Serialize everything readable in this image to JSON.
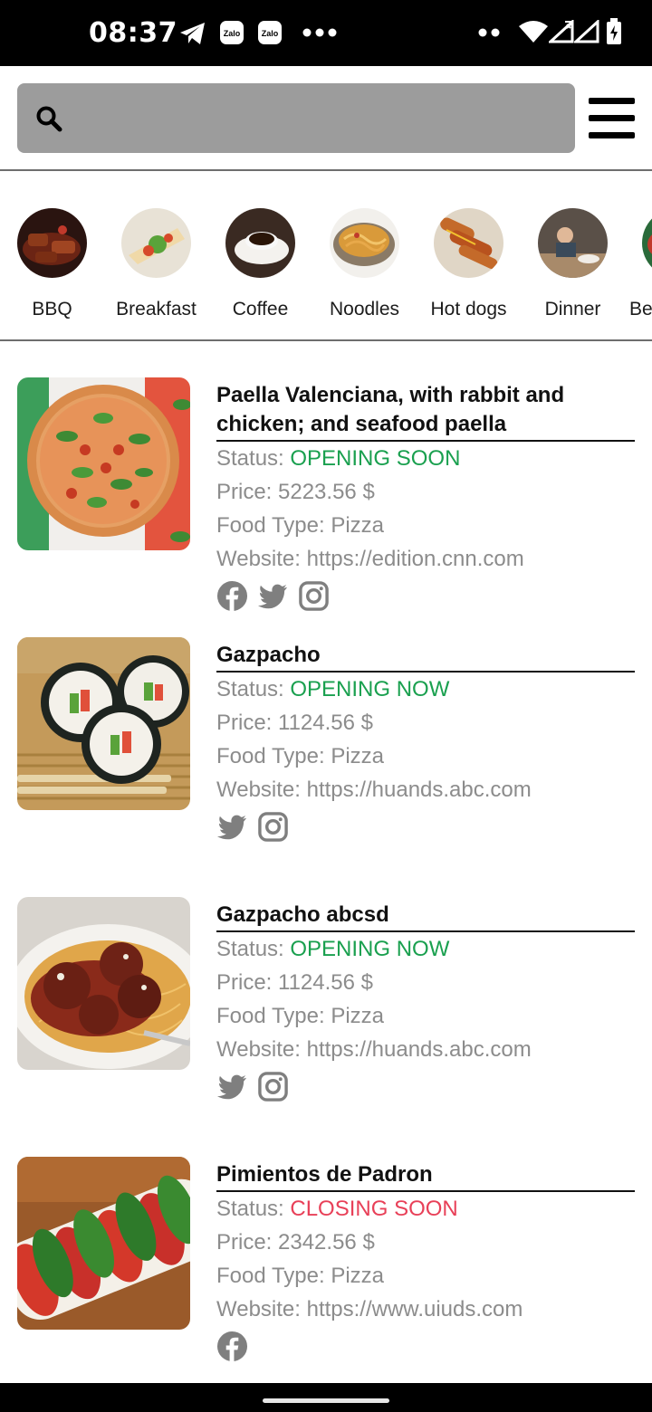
{
  "status_bar": {
    "time": "08:37",
    "left_icons": [
      "telegram-icon",
      "zalo-icon",
      "zalo-icon",
      "more-dots-icon"
    ],
    "zalo_text": "Zalo",
    "right_icons": [
      "dots-icon",
      "wifi-icon",
      "signal-icon",
      "signal-x-icon",
      "battery-charging-icon"
    ]
  },
  "header": {
    "search_placeholder": "",
    "search_icon": "search-icon",
    "menu_icon": "hamburger-menu-icon",
    "search_bg": "#9c9c9c"
  },
  "categories": [
    {
      "label": "BBQ",
      "icon": "bbq-photo"
    },
    {
      "label": "Breakfast",
      "icon": "breakfast-photo"
    },
    {
      "label": "Coffee",
      "icon": "coffee-photo"
    },
    {
      "label": "Noodles",
      "icon": "noodles-photo"
    },
    {
      "label": "Hot dogs",
      "icon": "hotdogs-photo"
    },
    {
      "label": "Dinner",
      "icon": "dinner-photo"
    },
    {
      "label": "Be",
      "icon": "beverage-photo"
    }
  ],
  "labels": {
    "status": "Status: ",
    "price": "Price: ",
    "food_type": "Food Type: ",
    "website": "Website: "
  },
  "colors": {
    "open": "#1aa04f",
    "closing": "#e84058",
    "muted_text": "#8c8c8c"
  },
  "restaurants": [
    {
      "title": "Paella Valenciana, with rabbit and chicken; and seafood paella",
      "status": "OPENING SOON",
      "status_color": "green",
      "price": "5223.56 $",
      "food_type": "Pizza",
      "website": "https://edition.cnn.com",
      "socials": [
        "facebook-icon",
        "twitter-icon",
        "instagram-icon"
      ],
      "image": "pizza-photo"
    },
    {
      "title": "Gazpacho",
      "status": "OPENING NOW",
      "status_color": "green",
      "price": "1124.56 $",
      "food_type": "Pizza",
      "website": "https://huands.abc.com",
      "socials": [
        "twitter-icon",
        "instagram-icon"
      ],
      "image": "sushi-photo"
    },
    {
      "title": "Gazpacho abcsd",
      "status": "OPENING NOW",
      "status_color": "green",
      "price": "1124.56 $",
      "food_type": "Pizza",
      "website": "https://huands.abc.com",
      "socials": [
        "twitter-icon",
        "instagram-icon"
      ],
      "image": "meatballs-spaghetti-photo"
    },
    {
      "title": "Pimientos de Padron",
      "status": "CLOSING SOON",
      "status_color": "red",
      "price": "2342.56 $",
      "food_type": "Pizza",
      "website": "https://www.uiuds.com",
      "socials": [
        "facebook-icon"
      ],
      "image": "caprese-photo"
    }
  ]
}
